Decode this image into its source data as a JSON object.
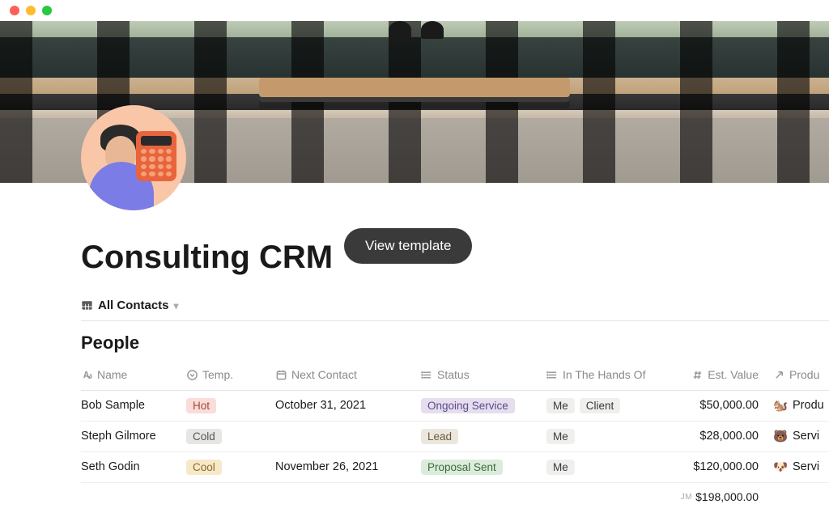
{
  "window": {
    "title": "Consulting CRM"
  },
  "header": {
    "page_title": "Consulting CRM",
    "view_template_button": "View template",
    "icon_desc": "person-with-calculator"
  },
  "view": {
    "name": "All Contacts",
    "icon": "table-icon"
  },
  "section": {
    "title": "People"
  },
  "columns": {
    "name": "Name",
    "temp": "Temp.",
    "next_contact": "Next Contact",
    "status": "Status",
    "hands_of": "In The Hands Of",
    "est_value": "Est. Value",
    "product": "Produ"
  },
  "rows": [
    {
      "name": "Bob Sample",
      "temp": "Hot",
      "temp_variant": "hot",
      "next_contact": "October 31, 2021",
      "status": "Ongoing Service",
      "status_variant": "ongoing",
      "hands": [
        "Me",
        "Client"
      ],
      "est_value": "$50,000.00",
      "product_emoji": "🐿️",
      "product_label": "Produ"
    },
    {
      "name": "Steph Gilmore",
      "temp": "Cold",
      "temp_variant": "cold",
      "next_contact": "",
      "status": "Lead",
      "status_variant": "lead",
      "hands": [
        "Me"
      ],
      "est_value": "$28,000.00",
      "product_emoji": "🐻",
      "product_label": "Servi"
    },
    {
      "name": "Seth Godin",
      "temp": "Cool",
      "temp_variant": "cool",
      "next_contact": "November 26, 2021",
      "status": "Proposal Sent",
      "status_variant": "proposal",
      "hands": [
        "Me"
      ],
      "est_value": "$120,000.00",
      "product_emoji": "🐶",
      "product_label": "Servi"
    }
  ],
  "summary": {
    "label": "JM",
    "est_value_total": "$198,000.00"
  }
}
